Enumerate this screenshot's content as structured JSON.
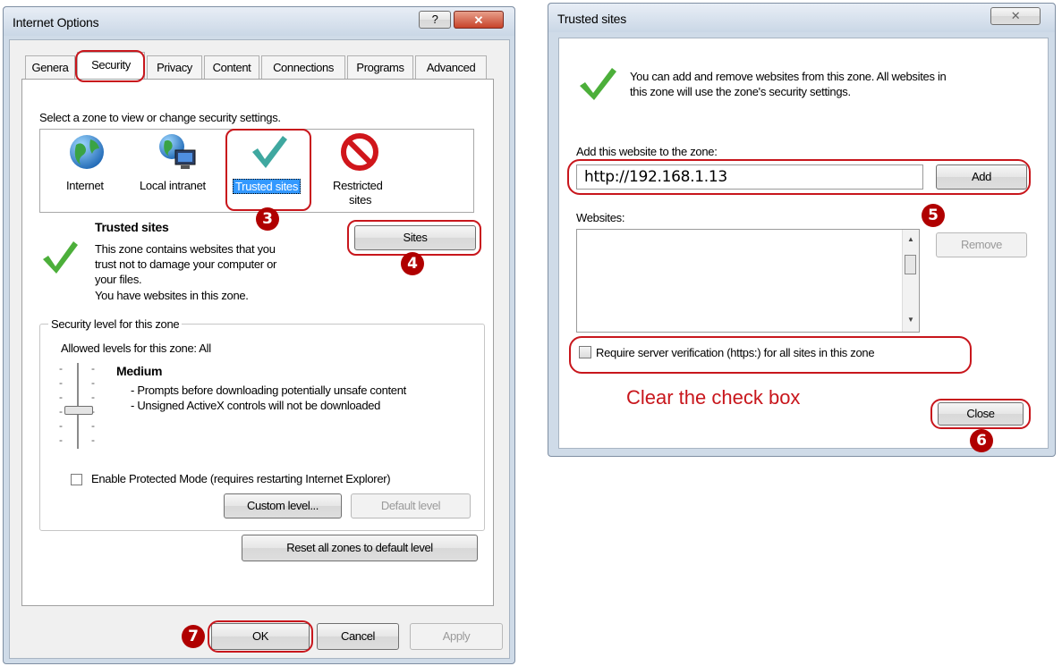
{
  "internet_options": {
    "title": "Internet Options",
    "help_glyph": "?",
    "close_glyph": "✕",
    "tabs": [
      "Genera",
      "Security",
      "Privacy",
      "Content",
      "Connections",
      "Programs",
      "Advanced"
    ],
    "zone_prompt": "Select a zone to view or change security settings.",
    "zones": [
      {
        "label": "Internet",
        "icon": "globe-icon"
      },
      {
        "label": "Local intranet",
        "icon": "intranet-icon"
      },
      {
        "label": "Trusted sites",
        "icon": "check-icon"
      },
      {
        "label_line1": "Restricted",
        "label_line2": "sites",
        "icon": "restricted-icon"
      }
    ],
    "zone_heading": "Trusted sites",
    "zone_desc": [
      "This zone contains websites that you",
      "trust not to damage your computer or",
      "your files.",
      "You have websites in this zone."
    ],
    "sites_button": "Sites",
    "security_group_title": "Security level for this zone",
    "allowed_levels": "Allowed levels for this zone: All",
    "level_name": "Medium",
    "level_bullets": [
      "- Prompts before downloading potentially unsafe content",
      "- Unsigned ActiveX controls will not be downloaded"
    ],
    "protected_mode_label": "Enable Protected Mode (requires restarting Internet Explorer)",
    "protected_mode_checked": false,
    "custom_level_button": "Custom level...",
    "default_level_button": "Default level",
    "reset_button": "Reset all zones to default level",
    "ok_button": "OK",
    "cancel_button": "Cancel",
    "apply_button": "Apply"
  },
  "trusted_sites": {
    "title": "Trusted sites",
    "close_glyph": "✕",
    "info_text_line1": "You can add and remove websites from this zone. All websites in",
    "info_text_line2": "this zone will use the zone's security settings.",
    "add_label": "Add this website to the zone:",
    "url_value": "http://192.168.1.13",
    "add_button": "Add",
    "websites_label": "Websites:",
    "remove_button": "Remove",
    "require_https_label": "Require server verification (https:) for all sites in this zone",
    "require_https_checked": false,
    "close_button": "Close"
  },
  "annotations": {
    "clear_check_box": "Clear the check box",
    "steps": [
      "3",
      "4",
      "5",
      "6",
      "7"
    ]
  },
  "colors": {
    "highlight_red": "#c8161c",
    "badge_red": "#b00000",
    "selection_blue": "#3399ff",
    "check_green": "#4caf3a"
  }
}
